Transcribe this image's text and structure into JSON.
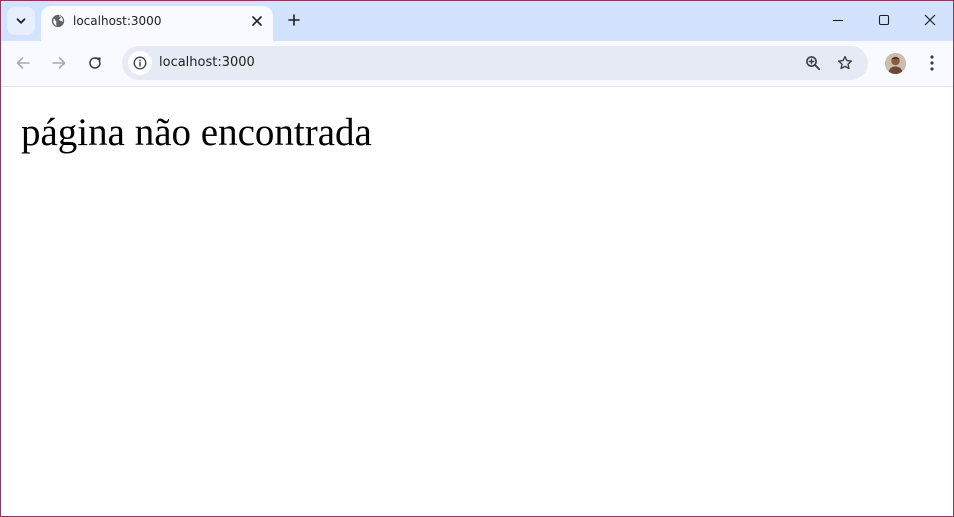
{
  "browser": {
    "tab": {
      "title": "localhost:3000"
    },
    "address_bar": {
      "url": "localhost:3000"
    },
    "icons": {
      "tab_search": "chevron-down-icon",
      "favicon": "globe-icon",
      "tab_close": "close-icon",
      "new_tab": "plus-icon",
      "back": "arrow-left-icon",
      "forward": "arrow-right-icon",
      "reload": "reload-icon",
      "site_info": "info-icon",
      "zoom": "zoom-in-icon",
      "bookmark": "star-icon",
      "profile": "avatar",
      "menu": "kebab-menu-icon",
      "minimize": "minimize-icon",
      "maximize": "maximize-icon",
      "close_window": "close-icon"
    },
    "colors": {
      "tabstrip": "#d3e3fd",
      "toolbar": "#f8faff",
      "omnibox": "#e6eaf4",
      "window_border": "#8a3a5c"
    }
  },
  "page": {
    "heading": "página não encontrada"
  }
}
